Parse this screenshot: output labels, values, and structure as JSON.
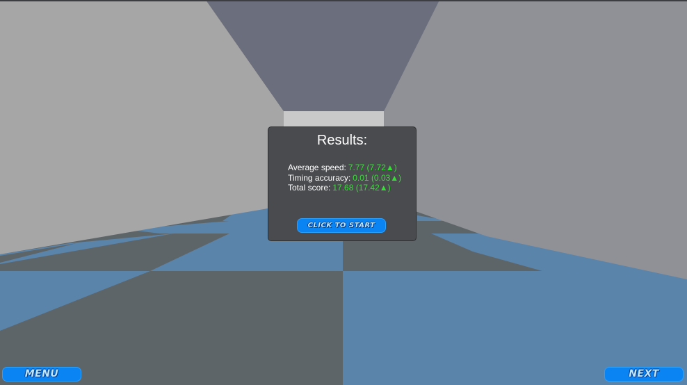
{
  "scene": {
    "colors": {
      "left_wall": "#a6a6a6",
      "right_wall": "#8f9196",
      "ceiling": "#6b6e7c",
      "far_wall": "#c9c9c9",
      "floor_dark": "#5e6568",
      "floor_light": "#5b84ab",
      "panel_bg": "#4a4b4e",
      "button_blue": "#0a84f2",
      "value_green": "#35e035"
    }
  },
  "results": {
    "title": "Results:",
    "average_speed": {
      "label": "Average speed:",
      "value": "7.77 (7.72▲)"
    },
    "timing_accuracy": {
      "label": "Timing accuracy:",
      "value": "0.01 (0.03▲)"
    },
    "total_score": {
      "label": "Total score:",
      "value": "17.68 (17.42▲)"
    },
    "start_label": "CLICK TO START"
  },
  "nav": {
    "menu_label": "MENU",
    "next_label": "NEXT"
  }
}
